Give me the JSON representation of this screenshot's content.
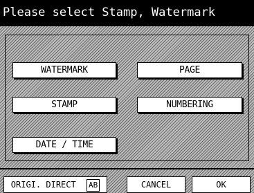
{
  "title": "Please select Stamp, Watermark",
  "buttons": {
    "watermark": "WATERMARK",
    "page": "PAGE",
    "stamp": "STAMP",
    "numbering": "NUMBERING",
    "date_time": "DATE / TIME"
  },
  "bottom": {
    "origi_direct": "ORIGI. DIRECT",
    "ab": "AB",
    "cancel": "CANCEL",
    "ok": "OK"
  }
}
